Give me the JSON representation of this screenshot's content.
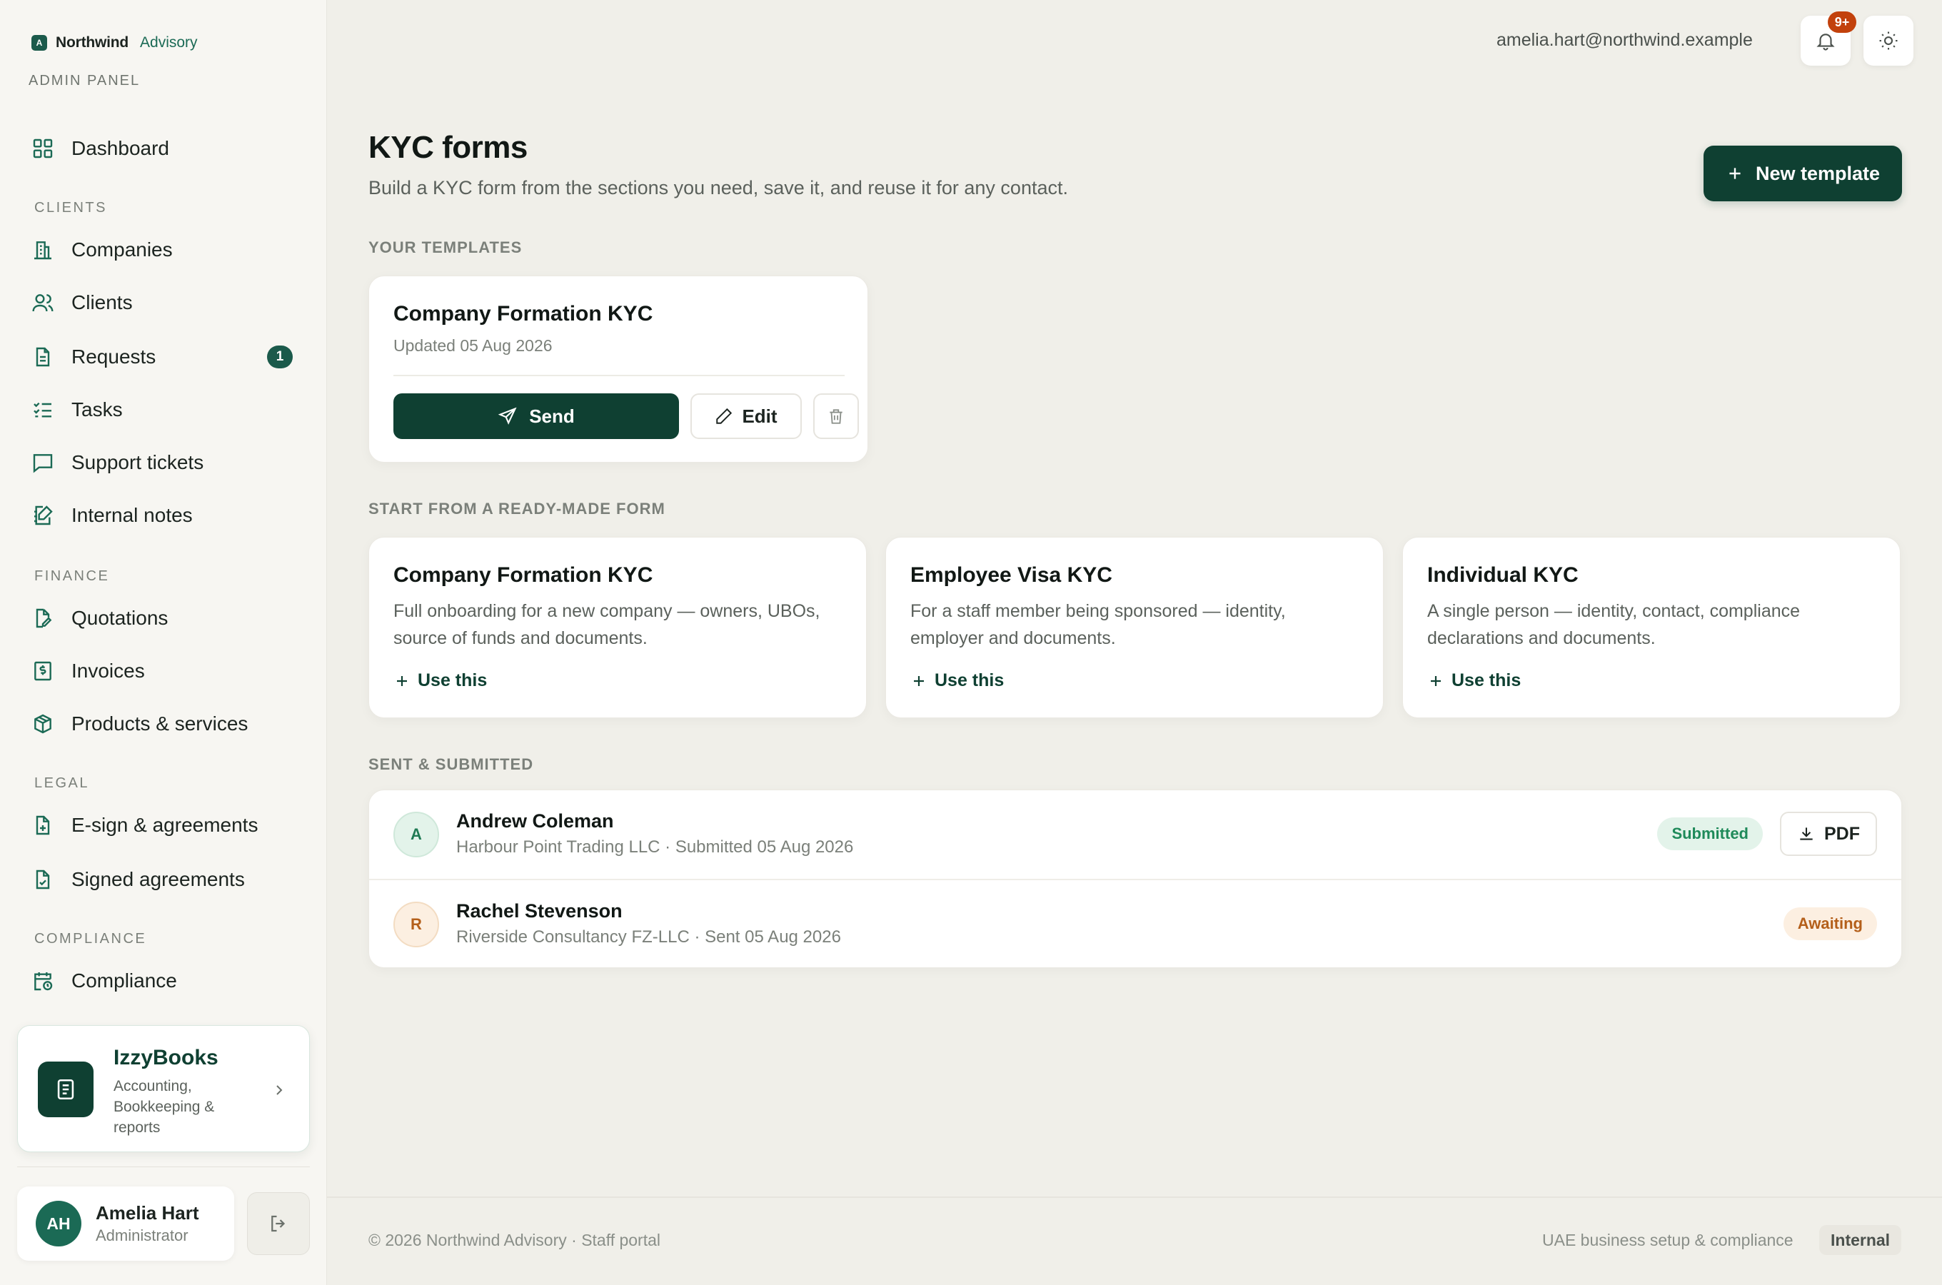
{
  "brand": {
    "name": "Northwind",
    "suffix": "Advisory",
    "mark": "A",
    "panel_label": "ADMIN PANEL"
  },
  "sidebar": {
    "dashboard": "Dashboard",
    "sections": {
      "clients": "CLIENTS",
      "finance": "FINANCE",
      "legal": "LEGAL",
      "compliance": "COMPLIANCE"
    },
    "items": [
      {
        "label": "Companies",
        "icon": "building-icon"
      },
      {
        "label": "Clients",
        "icon": "users-icon"
      },
      {
        "label": "Requests",
        "icon": "document-icon",
        "badge": "1"
      },
      {
        "label": "Tasks",
        "icon": "checklist-icon"
      },
      {
        "label": "Support tickets",
        "icon": "message-icon"
      },
      {
        "label": "Internal notes",
        "icon": "note-edit-icon"
      },
      {
        "label": "Quotations",
        "icon": "file-edit-icon"
      },
      {
        "label": "Invoices",
        "icon": "invoice-icon"
      },
      {
        "label": "Products & services",
        "icon": "box-icon"
      },
      {
        "label": "E-sign & agreements",
        "icon": "file-plus-icon"
      },
      {
        "label": "Signed agreements",
        "icon": "file-check-icon"
      },
      {
        "label": "Compliance",
        "icon": "calendar-clock-icon"
      }
    ],
    "promo": {
      "title": "IzzyBooks",
      "desc": "Accounting, Bookkeeping & reports"
    },
    "user": {
      "initials": "AH",
      "name": "Amelia Hart",
      "role": "Administrator"
    }
  },
  "topbar": {
    "email": "amelia.hart@northwind.example",
    "notif_badge": "9+"
  },
  "page": {
    "title": "KYC forms",
    "subtitle": "Build a KYC form from the sections you need, save it, and reuse it for any contact.",
    "new_template": "New template"
  },
  "templates": {
    "label": "YOUR TEMPLATES",
    "items": [
      {
        "title": "Company Formation KYC",
        "updated": "Updated 05 Aug 2026",
        "send": "Send",
        "edit": "Edit"
      }
    ]
  },
  "ready_made": {
    "label": "START FROM A READY-MADE FORM",
    "use_label": "Use this",
    "items": [
      {
        "title": "Company Formation KYC",
        "desc": "Full onboarding for a new company — owners, UBOs, source of funds and documents."
      },
      {
        "title": "Employee Visa KYC",
        "desc": "For a staff member being sponsored — identity, employer and documents."
      },
      {
        "title": "Individual KYC",
        "desc": "A single person — identity, contact, compliance declarations and documents."
      }
    ]
  },
  "sent": {
    "label": "SENT & SUBMITTED",
    "rows": [
      {
        "initial": "A",
        "name": "Andrew Coleman",
        "meta": "Harbour Point Trading LLC · Submitted 05 Aug 2026",
        "status": "Submitted",
        "action": "PDF"
      },
      {
        "initial": "R",
        "name": "Rachel Stevenson",
        "meta": "Riverside Consultancy FZ-LLC · Sent 05 Aug 2026",
        "status": "Awaiting"
      }
    ]
  },
  "footer": {
    "left": "© 2026 Northwind Advisory · Staff portal",
    "right": "UAE business setup & compliance",
    "tag": "Internal"
  },
  "colors": {
    "primary": "#0f4032",
    "accent": "#1b6a55",
    "submitted_bg": "#e3f3ea",
    "submitted_fg": "#1f8a5a",
    "awaiting_bg": "#fcefe1",
    "awaiting_fg": "#b45f1a",
    "notif": "#c2410c"
  }
}
